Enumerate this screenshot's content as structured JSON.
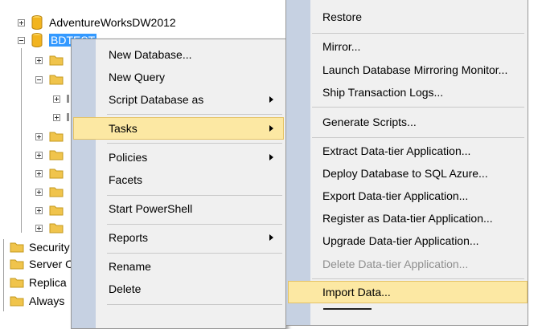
{
  "tree": {
    "nodes": [
      {
        "label": "AdventureWorksDW2012"
      },
      {
        "label": "BDTEST"
      }
    ],
    "server_nodes": [
      {
        "label": "Security"
      },
      {
        "label": "Server O"
      },
      {
        "label": "Replica"
      },
      {
        "label": "Always"
      }
    ]
  },
  "context_menu": {
    "items": [
      {
        "label": "New Database..."
      },
      {
        "label": "New Query"
      },
      {
        "label": "Script Database as"
      },
      {
        "label": "Tasks"
      },
      {
        "label": "Policies"
      },
      {
        "label": "Facets"
      },
      {
        "label": "Start PowerShell"
      },
      {
        "label": "Reports"
      },
      {
        "label": "Rename"
      },
      {
        "label": "Delete"
      }
    ]
  },
  "tasks_submenu": {
    "items": [
      {
        "label": "Restore"
      },
      {
        "label": "Mirror..."
      },
      {
        "label": "Launch Database Mirroring Monitor..."
      },
      {
        "label": "Ship Transaction Logs..."
      },
      {
        "label": "Generate Scripts..."
      },
      {
        "label": "Extract Data-tier Application..."
      },
      {
        "label": "Deploy Database to SQL Azure..."
      },
      {
        "label": "Export Data-tier Application..."
      },
      {
        "label": "Register as Data-tier Application..."
      },
      {
        "label": "Upgrade Data-tier Application..."
      },
      {
        "label": "Delete Data-tier Application..."
      },
      {
        "label": "Import Data..."
      }
    ]
  },
  "colors": {
    "menu_background": "#f0f0f0",
    "menu_gutter": "#c6d1e2",
    "highlight": "#fce8a3",
    "highlight_border": "#e5c365",
    "selection": "#3399ff",
    "disabled_text": "#8e8e8e",
    "folder": "#f0c44c",
    "database": "#f2b41f"
  }
}
